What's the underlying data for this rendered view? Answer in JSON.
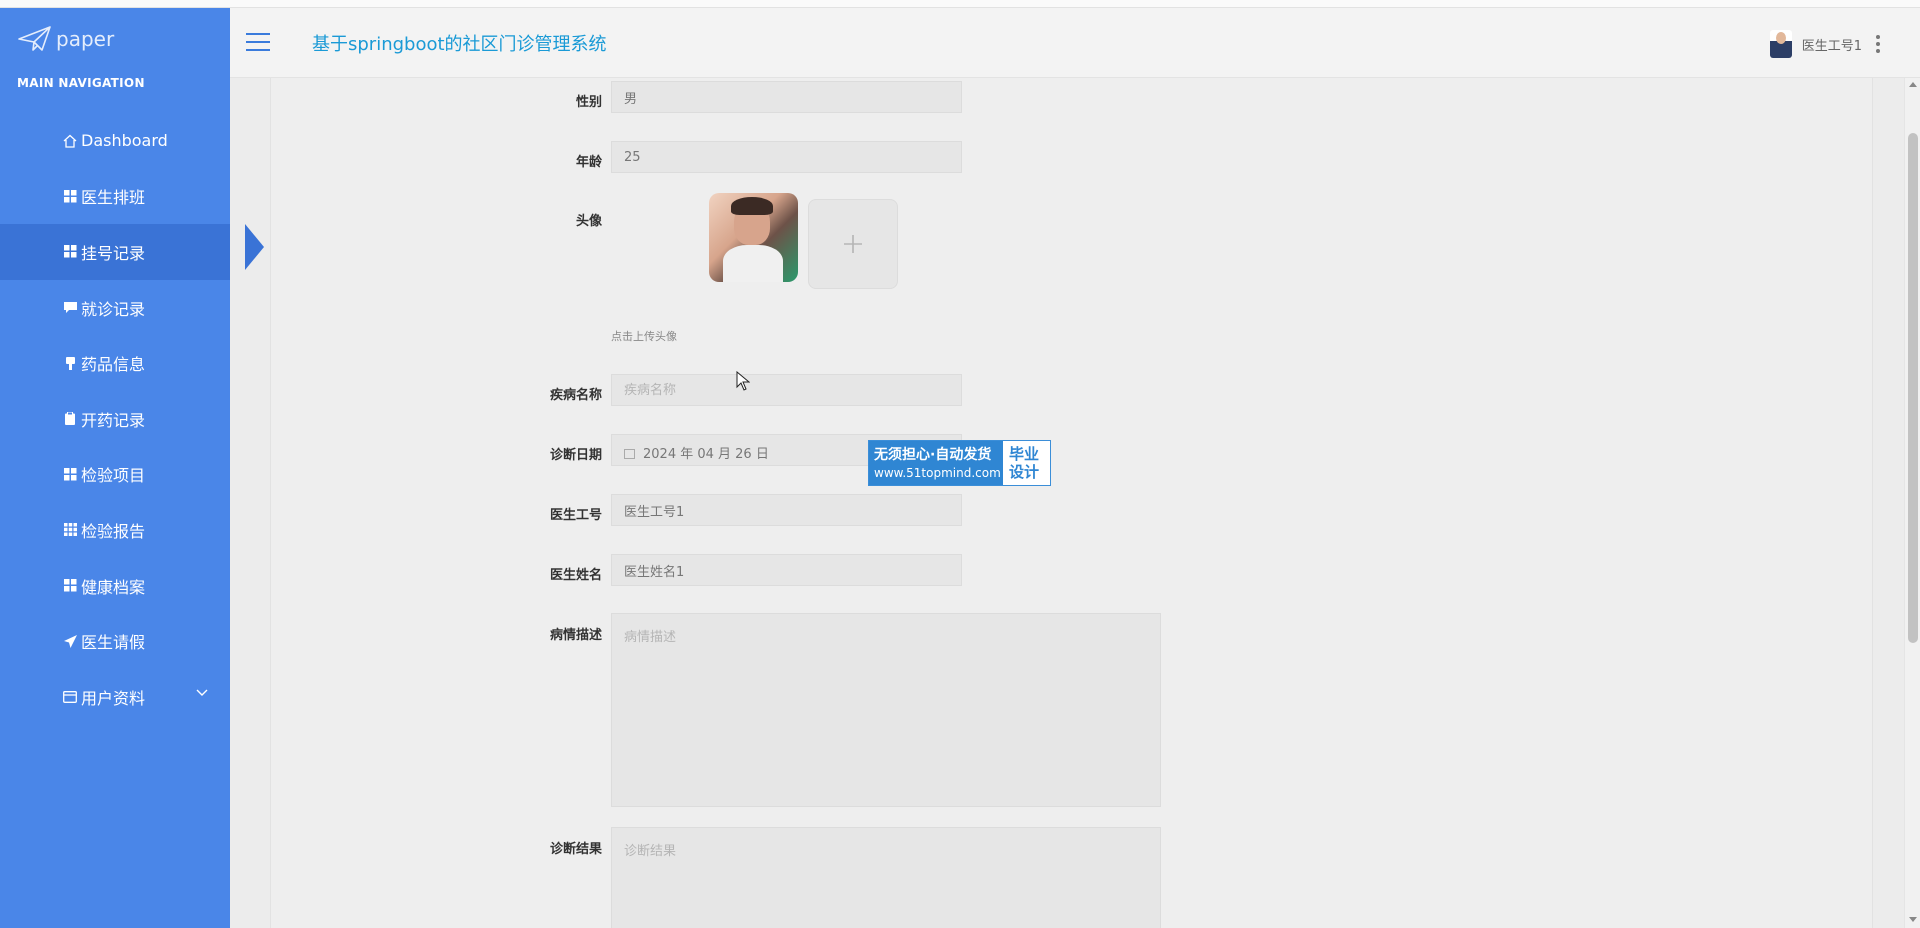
{
  "app": {
    "logo_text": "paper",
    "title": "基于springboot的社区门诊管理系统"
  },
  "sidebar": {
    "section_label": "MAIN NAVIGATION",
    "items": [
      {
        "label": "Dashboard",
        "icon": "home-icon"
      },
      {
        "label": "医生排班",
        "icon": "grid-icon"
      },
      {
        "label": "挂号记录",
        "icon": "grid-icon",
        "active": true
      },
      {
        "label": "就诊记录",
        "icon": "comment-icon"
      },
      {
        "label": "药品信息",
        "icon": "pill-icon"
      },
      {
        "label": "开药记录",
        "icon": "clipboard-icon"
      },
      {
        "label": "检验项目",
        "icon": "grid-icon"
      },
      {
        "label": "检验报告",
        "icon": "grid-3x3-icon"
      },
      {
        "label": "健康档案",
        "icon": "grid-icon"
      },
      {
        "label": "医生请假",
        "icon": "send-icon"
      },
      {
        "label": "用户资料",
        "icon": "card-icon",
        "has_submenu": true
      }
    ]
  },
  "header": {
    "user_name": "医生工号1"
  },
  "form": {
    "gender": {
      "label": "性别",
      "value": "男"
    },
    "age": {
      "label": "年龄",
      "value": "25"
    },
    "avatar": {
      "label": "头像",
      "hint": "点击上传头像",
      "upload_icon": "plus-icon"
    },
    "disease": {
      "label": "疾病名称",
      "placeholder": "疾病名称"
    },
    "diagnosis_date": {
      "label": "诊断日期",
      "value": "2024 年 04 月 26 日"
    },
    "doctor_id": {
      "label": "医生工号",
      "value": "医生工号1"
    },
    "doctor_name": {
      "label": "医生姓名",
      "value": "医生姓名1"
    },
    "description": {
      "label": "病情描述",
      "placeholder": "病情描述"
    },
    "result": {
      "label": "诊断结果",
      "placeholder": "诊断结果"
    }
  },
  "watermark": {
    "line1": "无须担心·自动发货",
    "line2": "www.51topmind.com",
    "right1": "毕业",
    "right2": "设计"
  },
  "colors": {
    "sidebar": "#4a86e8",
    "sidebar_active": "#3a73d6",
    "title": "#1a9ad6",
    "watermark": "#2f86d3"
  }
}
